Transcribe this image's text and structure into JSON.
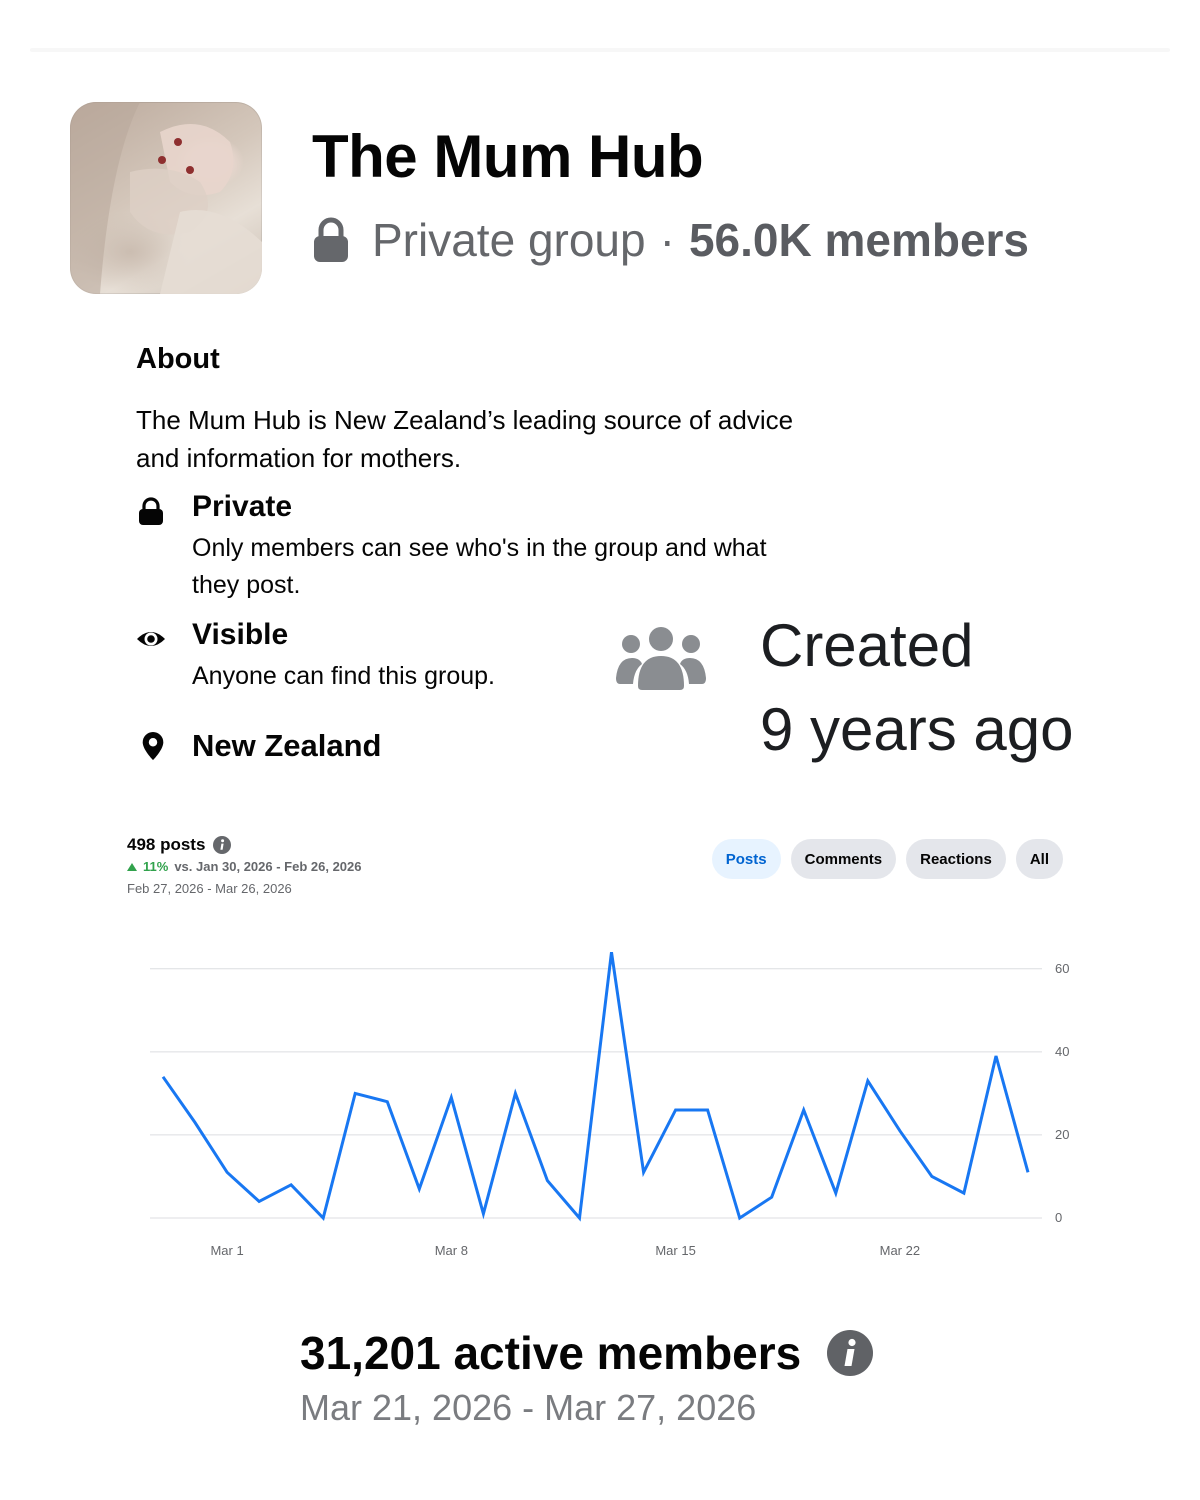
{
  "group": {
    "name": "The Mum Hub",
    "privacy": "Private group",
    "separator": "·",
    "members": "56.0K members"
  },
  "about": {
    "heading": "About",
    "description": "The Mum Hub is New Zealand’s leading source of advice and information for mothers.",
    "items": [
      {
        "title": "Private",
        "subtitle": "Only members can see who's in the group and what they post.",
        "icon": "lock-icon"
      },
      {
        "title": "Visible",
        "subtitle": "Anyone can find this group.",
        "icon": "eye-icon"
      },
      {
        "title": "New Zealand",
        "subtitle": "",
        "icon": "location-pin-icon"
      }
    ],
    "created_line1": "Created",
    "created_line2": "9 years ago",
    "created_icon": "people-group-icon"
  },
  "insights": {
    "count_label": "498 posts",
    "change_pct": "11%",
    "change_vs": "vs. Jan 30, 2026 - Feb 26, 2026",
    "date_range": "Feb 27, 2026 - Mar 26, 2026",
    "tabs": [
      "Posts",
      "Comments",
      "Reactions",
      "All"
    ],
    "active_tab": "Posts"
  },
  "chart_data": {
    "type": "line",
    "x": [
      "Feb 27",
      "Feb 28",
      "Mar 1",
      "Mar 2",
      "Mar 3",
      "Mar 4",
      "Mar 5",
      "Mar 6",
      "Mar 7",
      "Mar 8",
      "Mar 9",
      "Mar 10",
      "Mar 11",
      "Mar 12",
      "Mar 13",
      "Mar 14",
      "Mar 15",
      "Mar 16",
      "Mar 17",
      "Mar 18",
      "Mar 19",
      "Mar 20",
      "Mar 21",
      "Mar 22",
      "Mar 23",
      "Mar 24",
      "Mar 25",
      "Mar 26"
    ],
    "series": [
      {
        "values": [
          34,
          23,
          11,
          4,
          8,
          0,
          30,
          28,
          7,
          29,
          1,
          30,
          9,
          0,
          64,
          11,
          26,
          26,
          0,
          5,
          26,
          6,
          33,
          21,
          10,
          6,
          39,
          11
        ],
        "color": "#1877f2"
      }
    ],
    "x_tick_labels": [
      "Mar 1",
      "Mar 8",
      "Mar 15",
      "Mar 22"
    ],
    "y_ticks": [
      0,
      20,
      40,
      60
    ],
    "ylim": [
      0,
      65
    ],
    "grid": true,
    "y_axis_side": "right"
  },
  "active": {
    "count_label": "31,201 active members",
    "date_range": "Mar 21, 2026 - Mar 27, 2026"
  },
  "colors": {
    "accent": "#1877f2",
    "positive": "#31a24c",
    "secondary_text": "#65676b",
    "chip_bg": "#e4e6eb",
    "chip_active_bg": "#e7f3ff"
  }
}
